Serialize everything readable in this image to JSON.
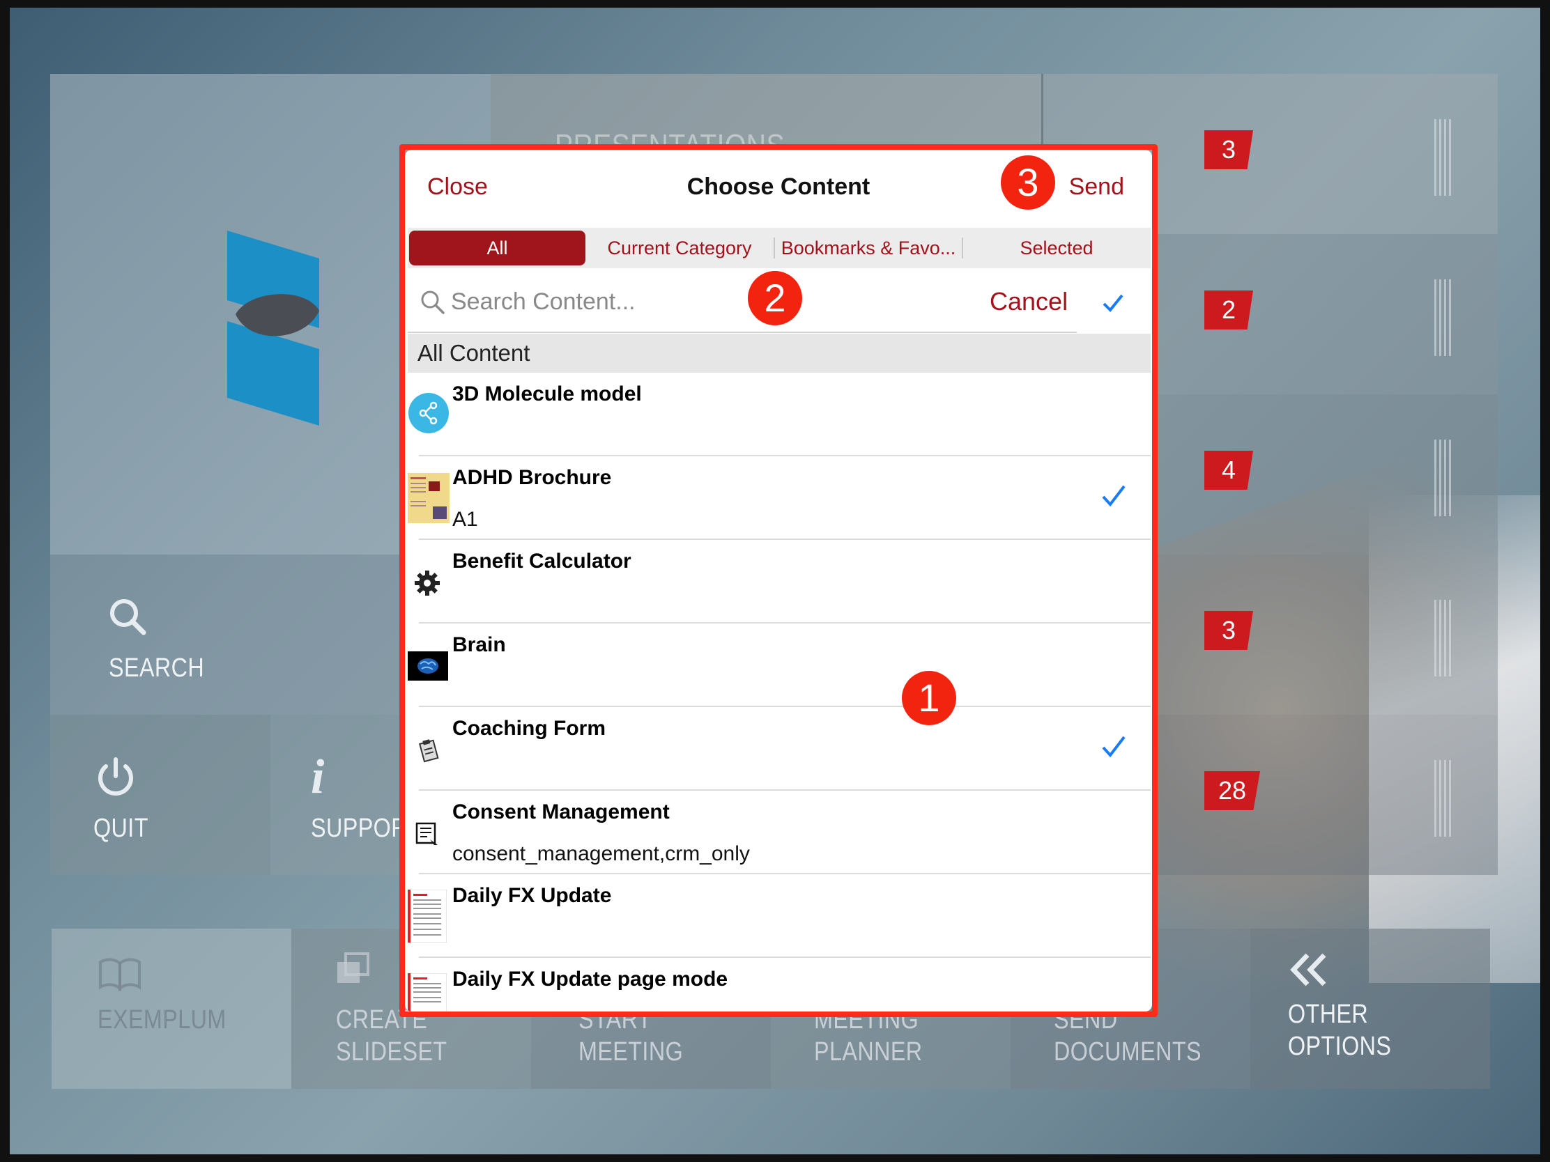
{
  "background": {
    "presentations_label": "PRESENTATIONS",
    "badges": [
      "3",
      "2",
      "4",
      "3",
      "28"
    ],
    "tiles": {
      "search": "SEARCH",
      "quit": "QUIT",
      "support": "SUPPORT"
    },
    "bottom_bar": {
      "exemplum": "EXEMPLUM",
      "create_slideset_1": "CREATE",
      "create_slideset_2": "SLIDESET",
      "start_meeting_1": "START",
      "start_meeting_2": "MEETING",
      "meeting_planner_1": "MEETING",
      "meeting_planner_2": "PLANNER",
      "send_documents_1": "SEND",
      "send_documents_2": "DOCUMENTS",
      "other_options_1": "OTHER",
      "other_options_2": "OPTIONS"
    }
  },
  "modal": {
    "close_label": "Close",
    "title": "Choose Content",
    "send_label": "Send",
    "segments": [
      "All",
      "Current Category",
      "Bookmarks & Favo...",
      "Selected"
    ],
    "active_segment": "All",
    "search": {
      "placeholder": "Search Content...",
      "value": "",
      "cancel_label": "Cancel"
    },
    "section_title": "All Content",
    "items": [
      {
        "title": "3D Molecule model",
        "subtitle": "",
        "icon": "share-icon",
        "selected": false
      },
      {
        "title": "ADHD Brochure",
        "subtitle": "A1",
        "icon": "brochure-thumbnail",
        "selected": true
      },
      {
        "title": "Benefit Calculator",
        "subtitle": "",
        "icon": "gear-icon",
        "selected": false
      },
      {
        "title": "Brain",
        "subtitle": "",
        "icon": "brain-thumbnail",
        "selected": false
      },
      {
        "title": "Coaching Form",
        "subtitle": "",
        "icon": "clipboard-icon",
        "selected": true
      },
      {
        "title": "Consent Management",
        "subtitle": "consent_management,crm_only",
        "icon": "form-icon",
        "selected": false
      },
      {
        "title": "Daily FX Update",
        "subtitle": "",
        "icon": "document-thumbnail",
        "selected": false
      },
      {
        "title": "Daily FX Update page mode",
        "subtitle": "",
        "icon": "document-thumbnail",
        "selected": false
      }
    ]
  },
  "callouts": [
    "1",
    "2",
    "3"
  ],
  "colors": {
    "accent": "#a3111b",
    "annotation_red": "#f2230f",
    "check_blue": "#1a7cf5",
    "badge_red": "#cc1a1e"
  }
}
